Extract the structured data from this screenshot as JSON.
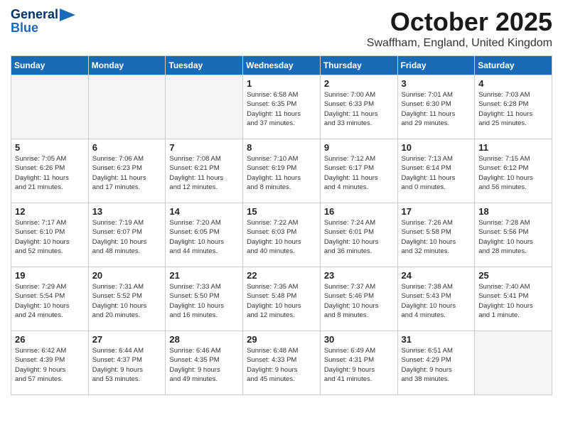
{
  "logo": {
    "line1": "General",
    "line2": "Blue"
  },
  "title": "October 2025",
  "location": "Swaffham, England, United Kingdom",
  "days_of_week": [
    "Sunday",
    "Monday",
    "Tuesday",
    "Wednesday",
    "Thursday",
    "Friday",
    "Saturday"
  ],
  "weeks": [
    {
      "days": [
        {
          "num": "",
          "text": ""
        },
        {
          "num": "",
          "text": ""
        },
        {
          "num": "",
          "text": ""
        },
        {
          "num": "1",
          "text": "Sunrise: 6:58 AM\nSunset: 6:35 PM\nDaylight: 11 hours\nand 37 minutes."
        },
        {
          "num": "2",
          "text": "Sunrise: 7:00 AM\nSunset: 6:33 PM\nDaylight: 11 hours\nand 33 minutes."
        },
        {
          "num": "3",
          "text": "Sunrise: 7:01 AM\nSunset: 6:30 PM\nDaylight: 11 hours\nand 29 minutes."
        },
        {
          "num": "4",
          "text": "Sunrise: 7:03 AM\nSunset: 6:28 PM\nDaylight: 11 hours\nand 25 minutes."
        }
      ]
    },
    {
      "days": [
        {
          "num": "5",
          "text": "Sunrise: 7:05 AM\nSunset: 6:26 PM\nDaylight: 11 hours\nand 21 minutes."
        },
        {
          "num": "6",
          "text": "Sunrise: 7:06 AM\nSunset: 6:23 PM\nDaylight: 11 hours\nand 17 minutes."
        },
        {
          "num": "7",
          "text": "Sunrise: 7:08 AM\nSunset: 6:21 PM\nDaylight: 11 hours\nand 12 minutes."
        },
        {
          "num": "8",
          "text": "Sunrise: 7:10 AM\nSunset: 6:19 PM\nDaylight: 11 hours\nand 8 minutes."
        },
        {
          "num": "9",
          "text": "Sunrise: 7:12 AM\nSunset: 6:17 PM\nDaylight: 11 hours\nand 4 minutes."
        },
        {
          "num": "10",
          "text": "Sunrise: 7:13 AM\nSunset: 6:14 PM\nDaylight: 11 hours\nand 0 minutes."
        },
        {
          "num": "11",
          "text": "Sunrise: 7:15 AM\nSunset: 6:12 PM\nDaylight: 10 hours\nand 56 minutes."
        }
      ]
    },
    {
      "days": [
        {
          "num": "12",
          "text": "Sunrise: 7:17 AM\nSunset: 6:10 PM\nDaylight: 10 hours\nand 52 minutes."
        },
        {
          "num": "13",
          "text": "Sunrise: 7:19 AM\nSunset: 6:07 PM\nDaylight: 10 hours\nand 48 minutes."
        },
        {
          "num": "14",
          "text": "Sunrise: 7:20 AM\nSunset: 6:05 PM\nDaylight: 10 hours\nand 44 minutes."
        },
        {
          "num": "15",
          "text": "Sunrise: 7:22 AM\nSunset: 6:03 PM\nDaylight: 10 hours\nand 40 minutes."
        },
        {
          "num": "16",
          "text": "Sunrise: 7:24 AM\nSunset: 6:01 PM\nDaylight: 10 hours\nand 36 minutes."
        },
        {
          "num": "17",
          "text": "Sunrise: 7:26 AM\nSunset: 5:58 PM\nDaylight: 10 hours\nand 32 minutes."
        },
        {
          "num": "18",
          "text": "Sunrise: 7:28 AM\nSunset: 5:56 PM\nDaylight: 10 hours\nand 28 minutes."
        }
      ]
    },
    {
      "days": [
        {
          "num": "19",
          "text": "Sunrise: 7:29 AM\nSunset: 5:54 PM\nDaylight: 10 hours\nand 24 minutes."
        },
        {
          "num": "20",
          "text": "Sunrise: 7:31 AM\nSunset: 5:52 PM\nDaylight: 10 hours\nand 20 minutes."
        },
        {
          "num": "21",
          "text": "Sunrise: 7:33 AM\nSunset: 5:50 PM\nDaylight: 10 hours\nand 16 minutes."
        },
        {
          "num": "22",
          "text": "Sunrise: 7:35 AM\nSunset: 5:48 PM\nDaylight: 10 hours\nand 12 minutes."
        },
        {
          "num": "23",
          "text": "Sunrise: 7:37 AM\nSunset: 5:46 PM\nDaylight: 10 hours\nand 8 minutes."
        },
        {
          "num": "24",
          "text": "Sunrise: 7:38 AM\nSunset: 5:43 PM\nDaylight: 10 hours\nand 4 minutes."
        },
        {
          "num": "25",
          "text": "Sunrise: 7:40 AM\nSunset: 5:41 PM\nDaylight: 10 hours\nand 1 minute."
        }
      ]
    },
    {
      "days": [
        {
          "num": "26",
          "text": "Sunrise: 6:42 AM\nSunset: 4:39 PM\nDaylight: 9 hours\nand 57 minutes."
        },
        {
          "num": "27",
          "text": "Sunrise: 6:44 AM\nSunset: 4:37 PM\nDaylight: 9 hours\nand 53 minutes."
        },
        {
          "num": "28",
          "text": "Sunrise: 6:46 AM\nSunset: 4:35 PM\nDaylight: 9 hours\nand 49 minutes."
        },
        {
          "num": "29",
          "text": "Sunrise: 6:48 AM\nSunset: 4:33 PM\nDaylight: 9 hours\nand 45 minutes."
        },
        {
          "num": "30",
          "text": "Sunrise: 6:49 AM\nSunset: 4:31 PM\nDaylight: 9 hours\nand 41 minutes."
        },
        {
          "num": "31",
          "text": "Sunrise: 6:51 AM\nSunset: 4:29 PM\nDaylight: 9 hours\nand 38 minutes."
        },
        {
          "num": "",
          "text": ""
        }
      ]
    }
  ]
}
